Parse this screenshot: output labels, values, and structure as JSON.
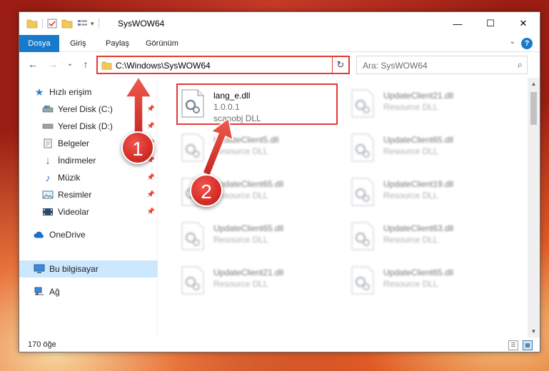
{
  "window": {
    "title": "SysWOW64",
    "controls": {
      "minimize": "—",
      "maximize": "☐",
      "close": "✕"
    }
  },
  "ribbon": {
    "tabs": [
      {
        "label": "Dosya"
      },
      {
        "label": "Giriş"
      },
      {
        "label": "Paylaş"
      },
      {
        "label": "Görünüm"
      }
    ],
    "help": "?",
    "expand": "⌄"
  },
  "navigation": {
    "back": "←",
    "forward": "→",
    "recent": "⌄",
    "up": "↑",
    "address": "C:\\Windows\\SysWOW64",
    "address_dropdown": "⌄",
    "refresh": "↻",
    "search_placeholder": "Ara: SysWOW64",
    "search_icon": "⌕"
  },
  "sidebar": {
    "quick_access": "Hızlı erişim",
    "items": [
      {
        "label": "Yerel Disk (C:)",
        "icon": "drive-icon"
      },
      {
        "label": "Yerel Disk (D:)",
        "icon": "drive-icon"
      },
      {
        "label": "Belgeler",
        "icon": "documents-icon"
      },
      {
        "label": "İndirmeler",
        "icon": "downloads-icon"
      },
      {
        "label": "Müzik",
        "icon": "music-icon"
      },
      {
        "label": "Resimler",
        "icon": "pictures-icon"
      },
      {
        "label": "Videolar",
        "icon": "videos-icon"
      }
    ],
    "onedrive": "OneDrive",
    "this_pc": "Bu bilgisayar",
    "network": "Ağ",
    "pin": "📌"
  },
  "files": [
    {
      "name": "lang_e.dll",
      "version": "1.0.0.1",
      "desc": "scanobj DLL"
    },
    {
      "name": "UpdateClient21.dll",
      "desc": "Resource DLL"
    },
    {
      "name": "UpdateClient5.dll",
      "desc": "Resource DLL"
    },
    {
      "name": "UpdateClient65.dll",
      "desc": "Resource DLL"
    },
    {
      "name": "UpdateClient65.dll",
      "desc": "Resource DLL"
    },
    {
      "name": "UpdateClient19.dll",
      "desc": "Resource DLL"
    },
    {
      "name": "UpdateClient65.dll",
      "desc": "Resource DLL"
    },
    {
      "name": "UpdateClient63.dll",
      "desc": "Resource DLL"
    },
    {
      "name": "UpdateClient21.dll",
      "desc": "Resource DLL"
    },
    {
      "name": "UpdateClient65.dll",
      "desc": "Resource DLL"
    }
  ],
  "status": {
    "count": "170 öğe"
  },
  "callouts": [
    {
      "number": "1"
    },
    {
      "number": "2"
    }
  ],
  "colors": {
    "accent": "#1979ca",
    "highlight": "#e53935",
    "selected": "#cce8ff"
  }
}
